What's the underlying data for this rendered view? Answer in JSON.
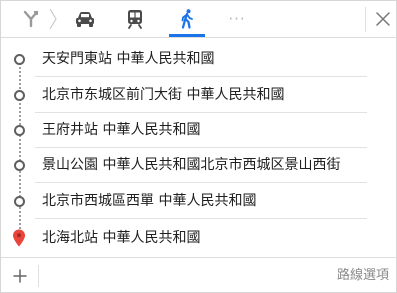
{
  "modes": {
    "route_icon": "route-split-icon",
    "car_icon": "car-icon",
    "transit_icon": "train-icon",
    "walk_icon": "walk-icon",
    "more": "···",
    "close_icon": "close-icon",
    "active_mode": "walk",
    "active_color": "#1a73e8"
  },
  "waypoints": [
    {
      "label": "天安門東站 中華人民共和國",
      "marker": "dot"
    },
    {
      "label": "北京市东城区前门大街 中華人民共和國",
      "marker": "dot"
    },
    {
      "label": "王府井站 中華人民共和國",
      "marker": "dot"
    },
    {
      "label": "景山公園 中華人民共和國北京市西城区景山西街",
      "marker": "dot"
    },
    {
      "label": "北京市西城區西單 中華人民共和國",
      "marker": "dot"
    },
    {
      "label": "北海北站 中華人民共和國",
      "marker": "destination-pin",
      "pin_color": "#e8453c"
    }
  ],
  "footer": {
    "add_icon": "plus-icon",
    "options_label": "路線選項"
  }
}
